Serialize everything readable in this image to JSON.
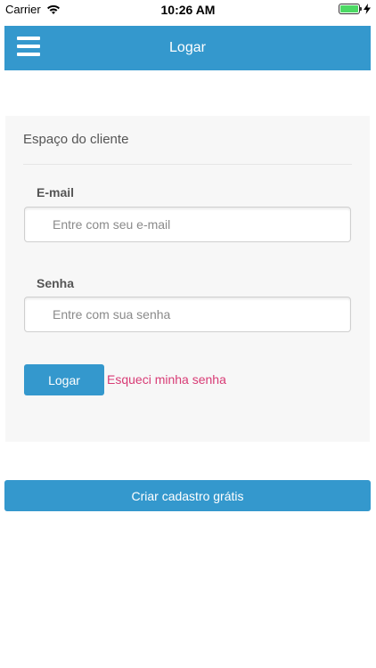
{
  "status_bar": {
    "carrier": "Carrier",
    "time": "10:26 AM",
    "battery_level": 1.0
  },
  "header": {
    "title": "Logar",
    "menu_icon": "hamburger-menu-icon"
  },
  "card": {
    "title": "Espaço do cliente",
    "email_label": "E-mail",
    "email_placeholder": "Entre com seu e-mail",
    "email_value": "",
    "password_label": "Senha",
    "password_placeholder": "Entre com sua senha",
    "password_value": "",
    "login_button": "Logar",
    "forgot_link": "Esqueci minha senha"
  },
  "signup_button": "Criar cadastro grátis",
  "colors": {
    "primary": "#3498cd",
    "link": "#d83b75",
    "card_bg": "#f7f7f7"
  }
}
